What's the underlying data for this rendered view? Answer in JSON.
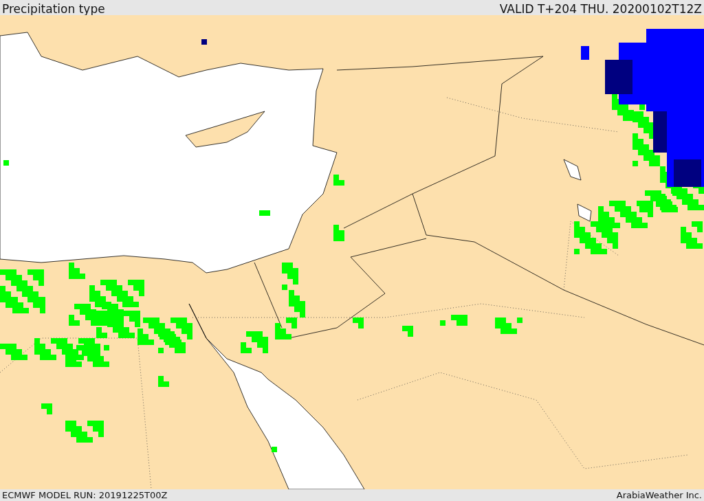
{
  "header": {
    "title": "Precipitation type",
    "valid": "VALID T+204 THU. 20200102T12Z"
  },
  "footer": {
    "model_run": "ECMWF MODEL RUN: 20191225T00Z",
    "credit": "ArabiaWeather Inc."
  }
}
